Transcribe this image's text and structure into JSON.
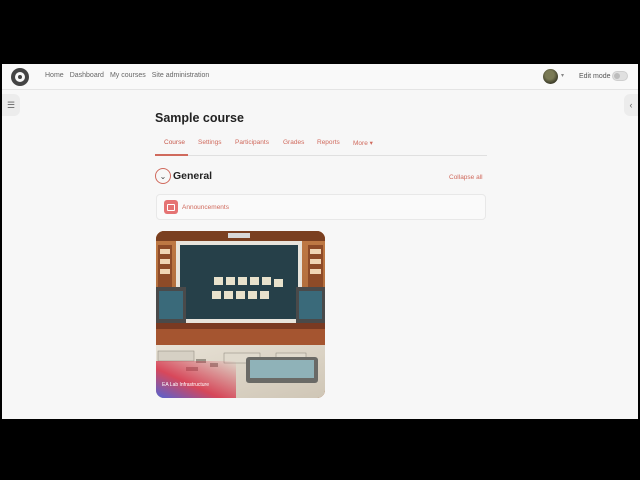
{
  "navbar": {
    "links": [
      "Home",
      "Dashboard",
      "My courses",
      "Site administration"
    ],
    "edit_mode_label": "Edit mode"
  },
  "page": {
    "title": "Sample course"
  },
  "tabs": [
    {
      "label": "Course",
      "active": true
    },
    {
      "label": "Settings"
    },
    {
      "label": "Participants"
    },
    {
      "label": "Grades"
    },
    {
      "label": "Reports"
    },
    {
      "label": "More ▾"
    }
  ],
  "section": {
    "title": "General",
    "collapse_label": "Collapse all",
    "activity_label": "Announcements"
  },
  "image": {
    "caption": "EA Lab Infrastructure"
  },
  "colors": {
    "accent": "#d06a5d",
    "overlay": "#f7f7f7"
  },
  "icons": [
    "moodle-logo-icon",
    "avatar",
    "toggle-icon",
    "drawer-icon",
    "chevron-down-icon",
    "forum-icon"
  ]
}
